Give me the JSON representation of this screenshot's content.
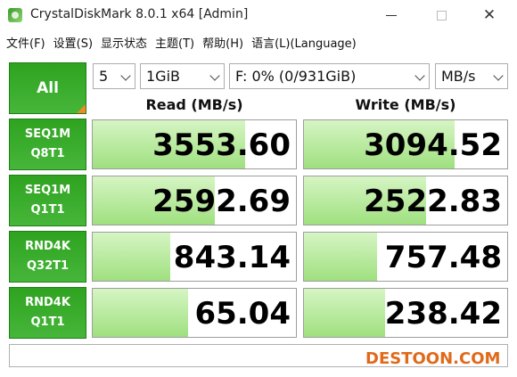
{
  "window": {
    "title": "CrystalDiskMark 8.0.1 x64 [Admin]",
    "min_label": "—",
    "close_label": "✕"
  },
  "menu": [
    "文件(F)",
    "设置(S)",
    "显示状态",
    "主题(T)",
    "帮助(H)",
    "语言(L)(Language)"
  ],
  "controls": {
    "all_label": "All",
    "runs": "5",
    "size": "1GiB",
    "drive": "F: 0% (0/931GiB)",
    "unit": "MB/s"
  },
  "headers": {
    "read": "Read (MB/s)",
    "write": "Write (MB/s)"
  },
  "rows": [
    {
      "line1": "SEQ1M",
      "line2": "Q8T1",
      "read": "3553.60",
      "write": "3094.52",
      "read_fill": 0.75,
      "write_fill": 0.74
    },
    {
      "line1": "SEQ1M",
      "line2": "Q1T1",
      "read": "2592.69",
      "write": "2522.83",
      "read_fill": 0.6,
      "write_fill": 0.6
    },
    {
      "line1": "RND4K",
      "line2": "Q32T1",
      "read": "843.14",
      "write": "757.48",
      "read_fill": 0.38,
      "write_fill": 0.36
    },
    {
      "line1": "RND4K",
      "line2": "Q1T1",
      "read": "65.04",
      "write": "238.42",
      "read_fill": 0.47,
      "write_fill": 0.4
    }
  ],
  "watermark": "DESTOON.COM",
  "colors": {
    "accent_green": "#2fa320",
    "bar_light": "#d6f5c4",
    "bar_dark": "#9fe07f",
    "corner_orange": "#f08a24"
  }
}
